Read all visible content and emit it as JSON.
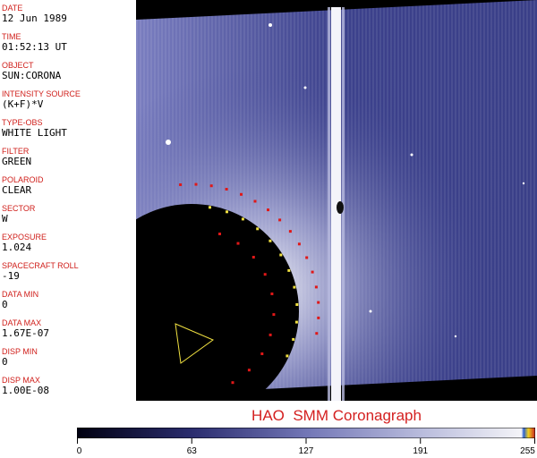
{
  "metadata": [
    {
      "label": "DATE",
      "value": "12 Jun 1989"
    },
    {
      "label": "TIME",
      "value": "01:52:13 UT"
    },
    {
      "label": "OBJECT",
      "value": "SUN:CORONA"
    },
    {
      "label": "INTENSITY SOURCE",
      "value": "(K+F)*V"
    },
    {
      "label": "TYPE-OBS",
      "value": "WHITE LIGHT"
    },
    {
      "label": "FILTER",
      "value": "GREEN"
    },
    {
      "label": "POLAROID",
      "value": "CLEAR"
    },
    {
      "label": "SECTOR",
      "value": "W"
    },
    {
      "label": "EXPOSURE",
      "value": "1.024"
    },
    {
      "label": "SPACECRAFT ROLL",
      "value": "-19"
    },
    {
      "label": "DATA MIN",
      "value": "0"
    },
    {
      "label": "DATA MAX",
      "value": "1.67E-07"
    },
    {
      "label": "DISP MIN",
      "value": "0"
    },
    {
      "label": "DISP MAX",
      "value": "1.00E-08"
    }
  ],
  "caption": "HAO  SMM Coronagraph",
  "colorbar": {
    "ticks": [
      "0",
      "63",
      "127",
      "191",
      "255"
    ],
    "colors": {
      "dark": "#000010",
      "mid": "#5a5fb0",
      "light": "#e8e8f4"
    }
  },
  "colors": {
    "label_red": "#d0201c",
    "caption_red": "#d42020",
    "occulter_dot_red": "#e01818",
    "occulter_dot_yellow": "#f0e040"
  }
}
